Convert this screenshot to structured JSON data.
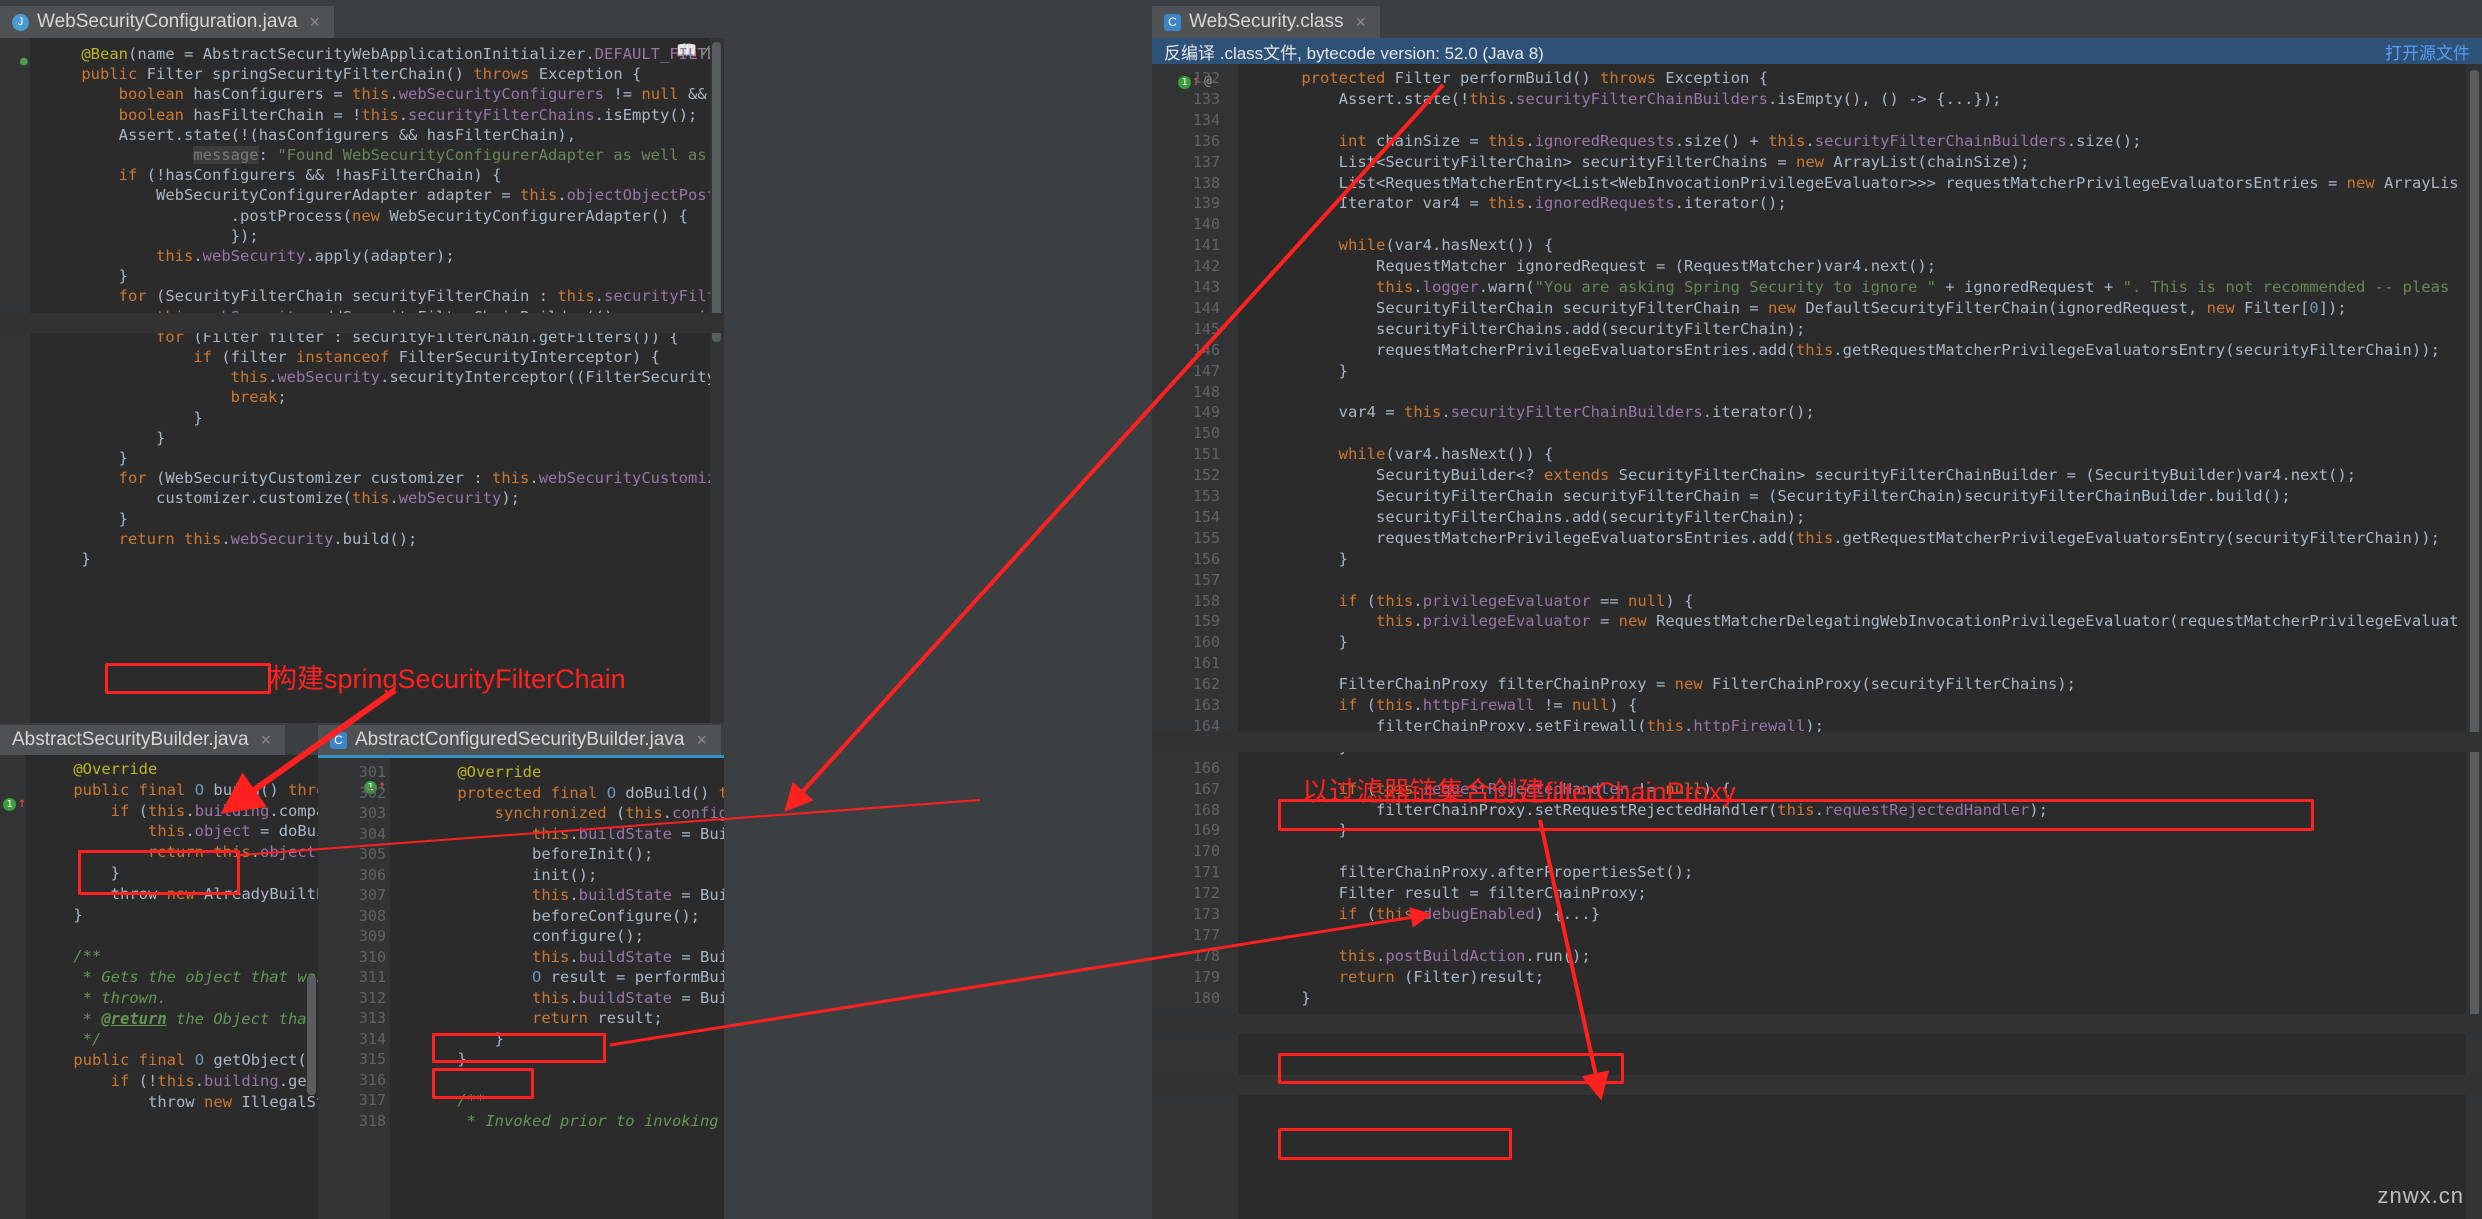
{
  "window": {
    "watermark": "znwx.cn"
  },
  "tabs_left": [
    {
      "label": "WebSecurityConfiguration.java",
      "icon": "java-file-icon",
      "active": true,
      "close": "×"
    }
  ],
  "tabs_right": [
    {
      "label": "WebSecurity.class",
      "icon": "class-file-icon",
      "active": true,
      "close": "×"
    }
  ],
  "tabs_bottom_left": [
    {
      "label": "AbstractSecurityBuilder.java",
      "icon": "java-file-icon",
      "active": true,
      "close": "×"
    }
  ],
  "tabs_bottom_mid": [
    {
      "label": "AbstractConfiguredSecurityBuilder.java",
      "icon": "class-file-icon",
      "active": true,
      "close": "×"
    }
  ],
  "decompile_notice": {
    "text": "反编译 .class文件, bytecode version: 52.0 (Java 8)",
    "action": "打开源文件"
  },
  "annotations": [
    {
      "id": "ann-build-springsecurityfilterchain",
      "text": "构建springSecurityFilterChain"
    },
    {
      "id": "ann-create-filterchainproxy",
      "text": "以过滤器链集合创建filterChainProxy"
    }
  ],
  "colors": {
    "accent_red": "#ff2020",
    "editor_bg": "#2b2b2b",
    "gutter_bg": "#313335",
    "notice_bg": "#2d5177"
  },
  "editor_main": {
    "file": "WebSecurityConfiguration.java",
    "lines": [
      "    @Bean(name = AbstractSecurityWebApplicationInitializer.DEFAULT_FILTER_NAME)",
      "    public Filter springSecurityFilterChain() throws Exception {",
      "        boolean hasConfigurers = this.webSecurityConfigurers != null && !this.webSecurityConfigurers.isEmpty();",
      "        boolean hasFilterChain = !this.securityFilterChains.isEmpty();",
      "        Assert.state(!(hasConfigurers && hasFilterChain),",
      "                message: \"Found WebSecurityConfigurerAdapter as well as SecurityFilterChain. Please select just",
      "        if (!hasConfigurers && !hasFilterChain) {",
      "            WebSecurityConfigurerAdapter adapter = this.objectObjectPostProcessor",
      "                    .postProcess(new WebSecurityConfigurerAdapter() {",
      "                    });",
      "            this.webSecurity.apply(adapter);",
      "        }",
      "        for (SecurityFilterChain securityFilterChain : this.securityFilterChains) {",
      "            this.webSecurity.addSecurityFilterChainBuilder(() -> securityFilterChain);",
      "            for (Filter filter : securityFilterChain.getFilters()) {",
      "                if (filter instanceof FilterSecurityInterceptor) {",
      "                    this.webSecurity.securityInterceptor((FilterSecurityInterceptor) filter);",
      "                    break;",
      "                }",
      "            }",
      "        }",
      "        for (WebSecurityCustomizer customizer : this.webSecurityCustomizers) {",
      "            customizer.customize(this.webSecurity);",
      "        }",
      "        return this.webSecurity.build();",
      "    }"
    ]
  },
  "editor_bottom_left": {
    "file": "AbstractSecurityBuilder.java",
    "lines": [
      "    @Override",
      "    public final O build() throws Exception {",
      "        if (this.building.compareAndSet( expect: false, update: true)) {",
      "            this.object = doBuild();",
      "            return this.object;",
      "        }",
      "        throw new AlreadyBuiltException(\"This object has already been built\");",
      "    }",
      "",
      "    /**",
      "     * Gets the object that was built. If it has not been built yet an Exception is",
      "     * thrown.",
      "     * @return the Object that was built",
      "     */",
      "    public final O getObject() {",
      "        if (!this.building.get()) {",
      "            throw new IllegalStateException(\"This object has not been built\");"
    ]
  },
  "editor_bottom_mid": {
    "file": "AbstractConfiguredSecurityBuilder.java",
    "first_line_no": 301,
    "lines": [
      {
        "no": 301,
        "text": "    @Override"
      },
      {
        "no": 302,
        "text": "    protected final O doBuild() throws Exception {"
      },
      {
        "no": 303,
        "text": "        synchronized (this.configurers) {"
      },
      {
        "no": 304,
        "text": "            this.buildState = BuildState.INITIALIZING;"
      },
      {
        "no": 305,
        "text": "            beforeInit();"
      },
      {
        "no": 306,
        "text": "            init();"
      },
      {
        "no": 307,
        "text": "            this.buildState = BuildState.CONFIGURING;"
      },
      {
        "no": 308,
        "text": "            beforeConfigure();"
      },
      {
        "no": 309,
        "text": "            configure();"
      },
      {
        "no": 310,
        "text": "            this.buildState = BuildState.BUILDING;"
      },
      {
        "no": 311,
        "text": "            O result = performBuild();"
      },
      {
        "no": 312,
        "text": "            this.buildState = BuildState.BUILT;"
      },
      {
        "no": 313,
        "text": "            return result;"
      },
      {
        "no": 314,
        "text": "        }"
      },
      {
        "no": 315,
        "text": "    }"
      },
      {
        "no": 316,
        "text": ""
      },
      {
        "no": 317,
        "text": "    /**"
      },
      {
        "no": 318,
        "text": "     * Invoked prior to invoking each {@link SecurityCon"
      }
    ]
  },
  "editor_right": {
    "file": "WebSecurity.class",
    "lines": [
      {
        "no": 132,
        "text": "    protected Filter performBuild() throws Exception {"
      },
      {
        "no": 133,
        "text": "        Assert.state(!this.securityFilterChainBuilders.isEmpty(), () -> {...});"
      },
      {
        "no": 134,
        "text": ""
      },
      {
        "no": 136,
        "text": "        int chainSize = this.ignoredRequests.size() + this.securityFilterChainBuilders.size();"
      },
      {
        "no": 137,
        "text": "        List<SecurityFilterChain> securityFilterChains = new ArrayList(chainSize);"
      },
      {
        "no": 138,
        "text": "        List<RequestMatcherEntry<List<WebInvocationPrivilegeEvaluator>>> requestMatcherPrivilegeEvaluatorsEntries = new ArrayLis"
      },
      {
        "no": 139,
        "text": "        Iterator var4 = this.ignoredRequests.iterator();"
      },
      {
        "no": 140,
        "text": ""
      },
      {
        "no": 141,
        "text": "        while(var4.hasNext()) {"
      },
      {
        "no": 142,
        "text": "            RequestMatcher ignoredRequest = (RequestMatcher)var4.next();"
      },
      {
        "no": 143,
        "text": "            this.logger.warn(\"You are asking Spring Security to ignore \" + ignoredRequest + \". This is not recommended -- pleas"
      },
      {
        "no": 144,
        "text": "            SecurityFilterChain securityFilterChain = new DefaultSecurityFilterChain(ignoredRequest, new Filter[0]);"
      },
      {
        "no": 145,
        "text": "            securityFilterChains.add(securityFilterChain);"
      },
      {
        "no": 146,
        "text": "            requestMatcherPrivilegeEvaluatorsEntries.add(this.getRequestMatcherPrivilegeEvaluatorsEntry(securityFilterChain));"
      },
      {
        "no": 147,
        "text": "        }"
      },
      {
        "no": 148,
        "text": ""
      },
      {
        "no": 149,
        "text": "        var4 = this.securityFilterChainBuilders.iterator();"
      },
      {
        "no": 150,
        "text": ""
      },
      {
        "no": 151,
        "text": "        while(var4.hasNext()) {"
      },
      {
        "no": 152,
        "text": "            SecurityBuilder<? extends SecurityFilterChain> securityFilterChainBuilder = (SecurityBuilder)var4.next();"
      },
      {
        "no": 153,
        "text": "            SecurityFilterChain securityFilterChain = (SecurityFilterChain)securityFilterChainBuilder.build();"
      },
      {
        "no": 154,
        "text": "            securityFilterChains.add(securityFilterChain);"
      },
      {
        "no": 155,
        "text": "            requestMatcherPrivilegeEvaluatorsEntries.add(this.getRequestMatcherPrivilegeEvaluatorsEntry(securityFilterChain));"
      },
      {
        "no": 156,
        "text": "        }"
      },
      {
        "no": 157,
        "text": ""
      },
      {
        "no": 158,
        "text": "        if (this.privilegeEvaluator == null) {"
      },
      {
        "no": 159,
        "text": "            this.privilegeEvaluator = new RequestMatcherDelegatingWebInvocationPrivilegeEvaluator(requestMatcherPrivilegeEvaluat"
      },
      {
        "no": 160,
        "text": "        }"
      },
      {
        "no": 161,
        "text": ""
      },
      {
        "no": 162,
        "text": "        FilterChainProxy filterChainProxy = new FilterChainProxy(securityFilterChains);"
      },
      {
        "no": 163,
        "text": "        if (this.httpFirewall != null) {"
      },
      {
        "no": 164,
        "text": "            filterChainProxy.setFirewall(this.httpFirewall);"
      },
      {
        "no": 165,
        "text": "        }"
      },
      {
        "no": 166,
        "text": ""
      },
      {
        "no": 167,
        "text": "        if (this.requestRejectedHandler != null) {"
      },
      {
        "no": 168,
        "text": "            filterChainProxy.setRequestRejectedHandler(this.requestRejectedHandler);"
      },
      {
        "no": 169,
        "text": "        }"
      },
      {
        "no": 170,
        "text": ""
      },
      {
        "no": 171,
        "text": "        filterChainProxy.afterPropertiesSet();"
      },
      {
        "no": 172,
        "text": "        Filter result = filterChainProxy;"
      },
      {
        "no": 173,
        "text": "        if (this.debugEnabled) {...}"
      },
      {
        "no": 177,
        "text": ""
      },
      {
        "no": 178,
        "text": "        this.postBuildAction.run();"
      },
      {
        "no": 179,
        "text": "        return (Filter)result;"
      },
      {
        "no": 180,
        "text": "    }"
      }
    ]
  }
}
